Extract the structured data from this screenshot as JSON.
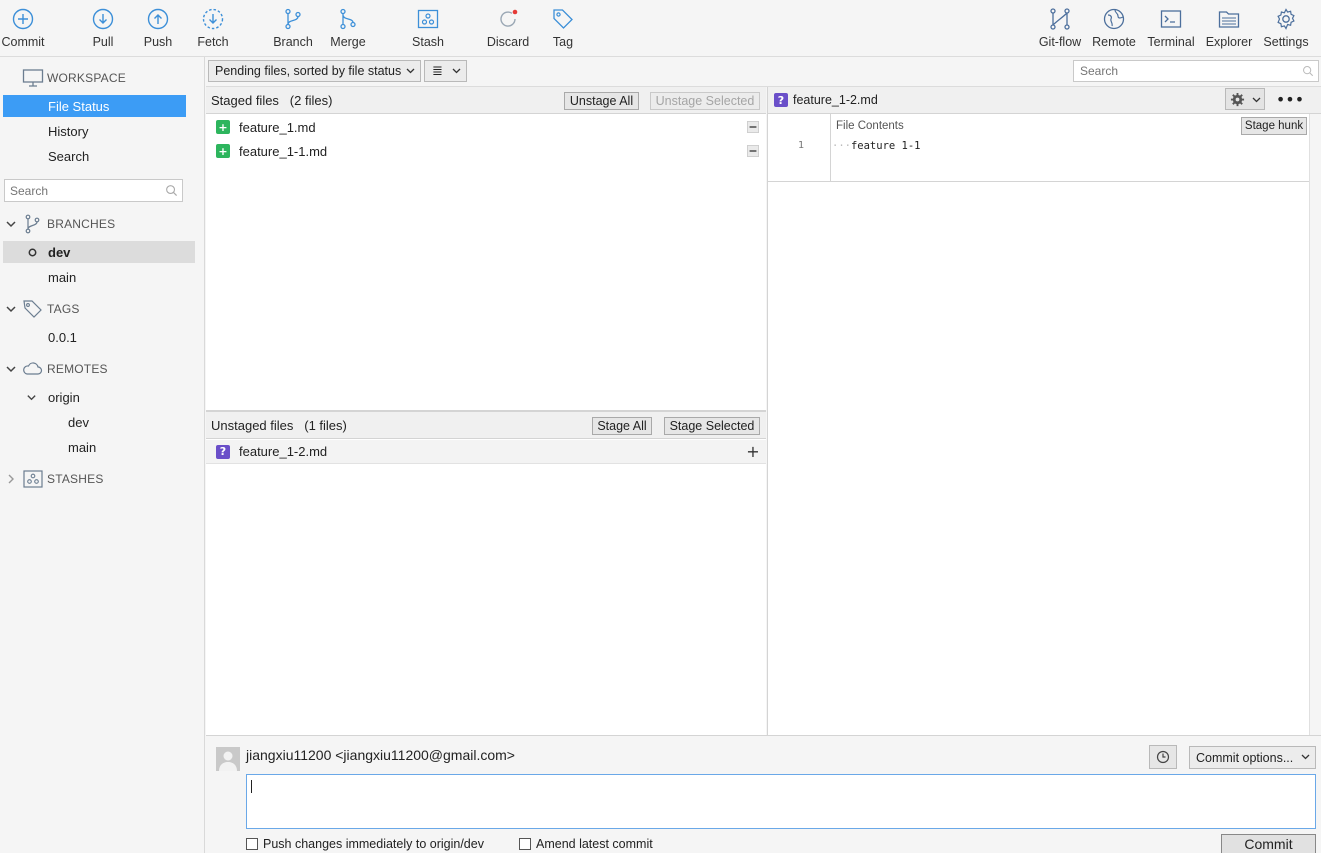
{
  "toolbar": {
    "left": [
      {
        "label": "Commit",
        "icon": "commit-icon"
      },
      {
        "label": "Pull",
        "icon": "pull-icon"
      },
      {
        "label": "Push",
        "icon": "push-icon"
      },
      {
        "label": "Fetch",
        "icon": "fetch-icon"
      },
      {
        "label": "Branch",
        "icon": "branch-icon"
      },
      {
        "label": "Merge",
        "icon": "merge-icon"
      },
      {
        "label": "Stash",
        "icon": "stash-icon"
      },
      {
        "label": "Discard",
        "icon": "discard-icon"
      },
      {
        "label": "Tag",
        "icon": "tag-icon"
      }
    ],
    "right": [
      {
        "label": "Git-flow",
        "icon": "git-flow-icon"
      },
      {
        "label": "Remote",
        "icon": "globe-icon"
      },
      {
        "label": "Terminal",
        "icon": "terminal-icon"
      },
      {
        "label": "Explorer",
        "icon": "folder-icon"
      },
      {
        "label": "Settings",
        "icon": "gear-icon"
      }
    ],
    "accent": "#3c8fd8",
    "discard_dot": "#e53935"
  },
  "sidebar": {
    "workspace": {
      "title": "WORKSPACE",
      "items": [
        "File Status",
        "History",
        "Search"
      ],
      "selected": "File Status"
    },
    "search_placeholder": "Search",
    "branches": {
      "title": "BRANCHES",
      "items": [
        "dev",
        "main"
      ],
      "current": "dev"
    },
    "tags": {
      "title": "TAGS",
      "items": [
        "0.0.1"
      ]
    },
    "remotes": {
      "title": "REMOTES",
      "origin": "origin",
      "items": [
        "dev",
        "main"
      ]
    },
    "stashes": {
      "title": "STASHES"
    }
  },
  "filter": {
    "sort_label": "Pending files, sorted by file status",
    "view_glyph": "≣",
    "search_placeholder": "Search"
  },
  "staged": {
    "title": "Staged files",
    "count": "(2 files)",
    "unstage_all": "Unstage All",
    "unstage_selected": "Unstage Selected",
    "files": [
      {
        "name": "feature_1.md",
        "status": "added"
      },
      {
        "name": "feature_1-1.md",
        "status": "added"
      }
    ]
  },
  "unstaged": {
    "title": "Unstaged files",
    "count": "(1 files)",
    "stage_all": "Stage All",
    "stage_selected": "Stage Selected",
    "files": [
      {
        "name": "feature_1-2.md",
        "status": "untracked"
      }
    ]
  },
  "diff": {
    "file": "feature_1-2.md",
    "hunk_title": "File Contents",
    "stage_hunk": "Stage hunk",
    "lines": [
      {
        "number": "1",
        "text": "feature 1-1",
        "prefix": "···"
      }
    ]
  },
  "commit": {
    "author": "jiangxiu11200 <jiangxiu11200@gmail.com>",
    "options_label": "Commit options...",
    "push_label": "Push changes immediately to origin/dev",
    "amend_label": "Amend latest commit",
    "commit_button": "Commit"
  },
  "colors": {
    "selection": "#3c9cf5",
    "added_badge": "#2db55d",
    "untracked_badge": "#6a4fc9"
  }
}
